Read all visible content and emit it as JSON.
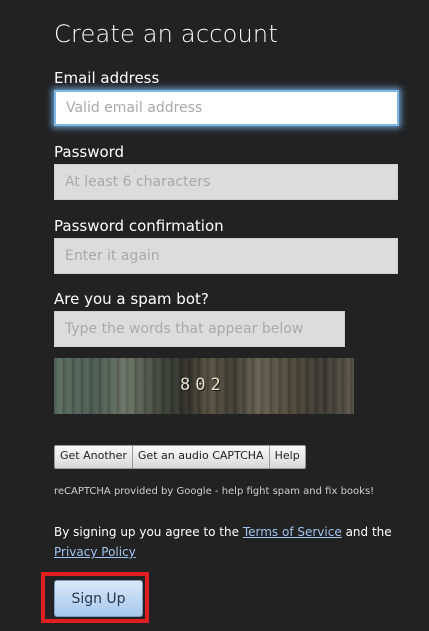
{
  "form": {
    "title": "Create an account",
    "email": {
      "label": "Email address",
      "placeholder": "Valid email address",
      "value": ""
    },
    "password": {
      "label": "Password",
      "placeholder": "At least 6 characters",
      "value": ""
    },
    "password_confirmation": {
      "label": "Password confirmation",
      "placeholder": "Enter it again",
      "value": ""
    },
    "spam_check": {
      "label": "Are you a spam bot?",
      "placeholder": "Type the words that appear below",
      "value": ""
    }
  },
  "captcha": {
    "image_text": "802",
    "buttons": [
      "Get Another",
      "Get an audio CAPTCHA",
      "Help"
    ],
    "note": "reCAPTCHA provided by Google - help fight spam and fix books!"
  },
  "terms": {
    "prefix": "By signing up you agree to the",
    "tos_link": "Terms of Service",
    "middle": "and the",
    "privacy_link": "Privacy Policy"
  },
  "submit": {
    "label": "Sign Up"
  },
  "colors": {
    "background": "#222222",
    "focus_glow": "#7fb8e6",
    "link": "#9fc4f0",
    "highlight": "#e02020",
    "button": "#a8c8ec"
  }
}
